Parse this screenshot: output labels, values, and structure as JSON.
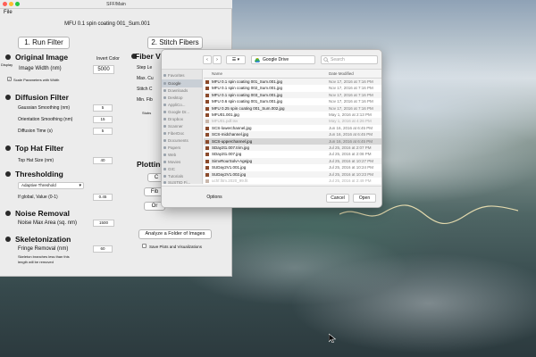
{
  "menubar": {
    "file": "File",
    "app_title": "SFF/Main"
  },
  "window": {
    "title": "MFU 0.1 spin coating 001_Sum.001"
  },
  "left": {
    "run_filter": "1. Run Filter",
    "original_image": {
      "heading": "Original Image",
      "display": "Display",
      "invert_color": "Invert Color",
      "image_width_label": "Image Width (nm)",
      "image_width_value": "5000",
      "scale_params": "Scale Parameters with Width"
    },
    "diffusion": {
      "heading": "Diffusion Filter",
      "gauss_label": "Gaussian Smoothing (nm)",
      "gauss_value": "5",
      "orient_label": "Orientation Smoothing (nm)",
      "orient_value": "15",
      "time_label": "Diffusion Time (s)",
      "time_value": "5"
    },
    "tophat": {
      "heading": "Top Hat Filter",
      "size_label": "Top Hat Size (nm)",
      "size_value": "40"
    },
    "threshold": {
      "heading": "Thresholding",
      "method": "Adaptive Threshold",
      "global_label": "If global, Value (0-1)",
      "global_value": "0.45"
    },
    "noise": {
      "heading": "Noise Removal",
      "max_area_label": "Noise Max Area (sq. nm)",
      "max_area_value": "1500"
    },
    "skeleton": {
      "heading": "Skeletonization",
      "fringe_label": "Fringe Removal (nm)",
      "fringe_value": "60",
      "note_line1": "Skeleton branches less than this",
      "note_line2": "length will be removed"
    }
  },
  "right": {
    "stitch": "2. Stitch Fibers",
    "fiber_heading": "Fiber V",
    "step_len": "Step Le",
    "max_cu": "Max. Cu",
    "stitch_c": "Stitch C",
    "min_fib": "Min. Fib",
    "stubs": "Stubs",
    "plotting": "Plotting",
    "c_btn": "C",
    "fib_btn": "Fib",
    "or_btn": "Or",
    "analyze_folder": "Analyze a Folder of Images",
    "save_plots": "Save Plots and Visualizations"
  },
  "dialog": {
    "location": "Google Drive",
    "search_placeholder": "Search",
    "sidebar_heading": "Favorites",
    "sidebar": [
      "Favorites",
      "Google",
      "Downloads",
      "Desktop",
      "AppliCo...",
      "Google Dr...",
      "Dropbox",
      "Scanner",
      "FiberDoc",
      "Documents",
      "Papers",
      "Web",
      "Movies",
      "GIC",
      "Tutorials",
      "SUSTID Fi..."
    ],
    "col_name": "Name",
    "col_date": "Date Modified",
    "files": [
      {
        "name": "MFU 0.1 spin coating 001_Sum.001.jpg",
        "date": "Nov 17, 2016 at 7:16 PM",
        "dim": false,
        "sel": false
      },
      {
        "name": "MFU 0.1 spin coating 002_Sum.001.jpg",
        "date": "Nov 17, 2016 at 7:16 PM",
        "dim": false,
        "sel": false
      },
      {
        "name": "MFU 0.1 spin coating 003_Sum.001.jpg",
        "date": "Nov 17, 2016 at 7:16 PM",
        "dim": false,
        "sel": false
      },
      {
        "name": "MFU 0.6 spin coating 001_Sum.001.jpg",
        "date": "Nov 17, 2016 at 7:16 PM",
        "dim": false,
        "sel": false
      },
      {
        "name": "MFU 0.25 spin coating 001_Sum.002.jpg",
        "date": "Nov 17, 2016 at 7:16 PM",
        "dim": false,
        "sel": false
      },
      {
        "name": "MFU01.001.jpg",
        "date": "May 1, 2016 at 2:13 PM",
        "dim": false,
        "sel": false
      },
      {
        "name": "MFU01.pdf.tsv",
        "date": "May 1, 2016 at 4:26 PM",
        "dim": true,
        "sel": false
      },
      {
        "name": "SCS-lowerchannel.jpg",
        "date": "Jun 16, 2016 at 6:45 PM",
        "dim": false,
        "sel": false
      },
      {
        "name": "SCS-midchannel.jpg",
        "date": "Jun 16, 2016 at 6:45 PM",
        "dim": false,
        "sel": false
      },
      {
        "name": "SCS-upperchannel.jpg",
        "date": "Jun 16, 2016 at 6:45 PM",
        "dim": false,
        "sel": true
      },
      {
        "name": "SDay2t1.007.trim.jpg",
        "date": "Jul 25, 2016 at 2:07 PM",
        "dim": false,
        "sel": false
      },
      {
        "name": "SDay2t1.007.jpg",
        "date": "Jul 25, 2016 at 2:08 PM",
        "dim": false,
        "sel": false
      },
      {
        "name": "SimvRourSolv+Agejpg",
        "date": "Jul 25, 2016 at 10:27 PM",
        "dim": false,
        "sel": false
      },
      {
        "name": "SUDay2V1.001.jpg",
        "date": "Jul 25, 2016 at 10:24 PM",
        "dim": false,
        "sel": false
      },
      {
        "name": "SUDay2V1.002.jpg",
        "date": "Jul 25, 2016 at 10:23 PM",
        "dim": false,
        "sel": false
      },
      {
        "name": "uchf.fitm.2020_99.fit",
        "date": "Jul 25, 2016 at 2:49 PM",
        "dim": true,
        "sel": false
      }
    ],
    "options": "Options",
    "cancel": "Cancel",
    "open": "Open"
  },
  "colors": {
    "accent": "#2a2a2a",
    "file_icon": "#8b4a2b",
    "selection": "#d6d6d6"
  }
}
